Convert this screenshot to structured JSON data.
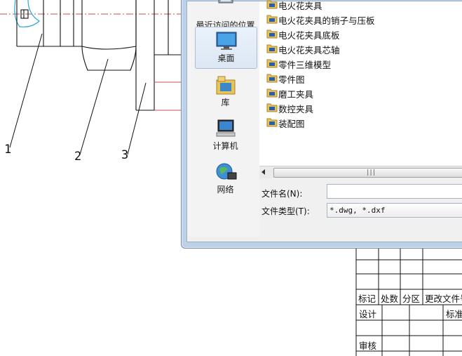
{
  "drawing": {
    "balloon_labels": [
      "1",
      "2",
      "3"
    ]
  },
  "title_block": {
    "row_headers": [
      "标记",
      "处数",
      "分区",
      "更改文件号"
    ],
    "design_label": "设计",
    "standard_label": "标准",
    "review_label": "审核"
  },
  "dialog": {
    "places": [
      {
        "label": "最近访问的位置",
        "icon": "recent-places-icon"
      },
      {
        "label": "桌面",
        "icon": "desktop-icon"
      },
      {
        "label": "库",
        "icon": "libraries-icon"
      },
      {
        "label": "计算机",
        "icon": "computer-icon"
      },
      {
        "label": "网络",
        "icon": "network-icon"
      }
    ],
    "files": [
      "电火花夹具",
      "电火花夹具的销子与压板",
      "电火花夹具底板",
      "电火花夹具芯轴",
      "零件三维模型",
      "零件图",
      "磨工夹具",
      "数控夹具",
      "装配图"
    ],
    "filename_label": "文件名(N):",
    "filename_value": "",
    "filetype_label": "文件类型(T):",
    "filetype_value": "*.dwg, *.dxf",
    "scroll_grip": "|||"
  },
  "colors": {
    "dialog_frame": "#bcd0e6",
    "centerline": "#c0504d",
    "cyan_curve": "#2aa8d8",
    "folder": "#e8c25a"
  }
}
